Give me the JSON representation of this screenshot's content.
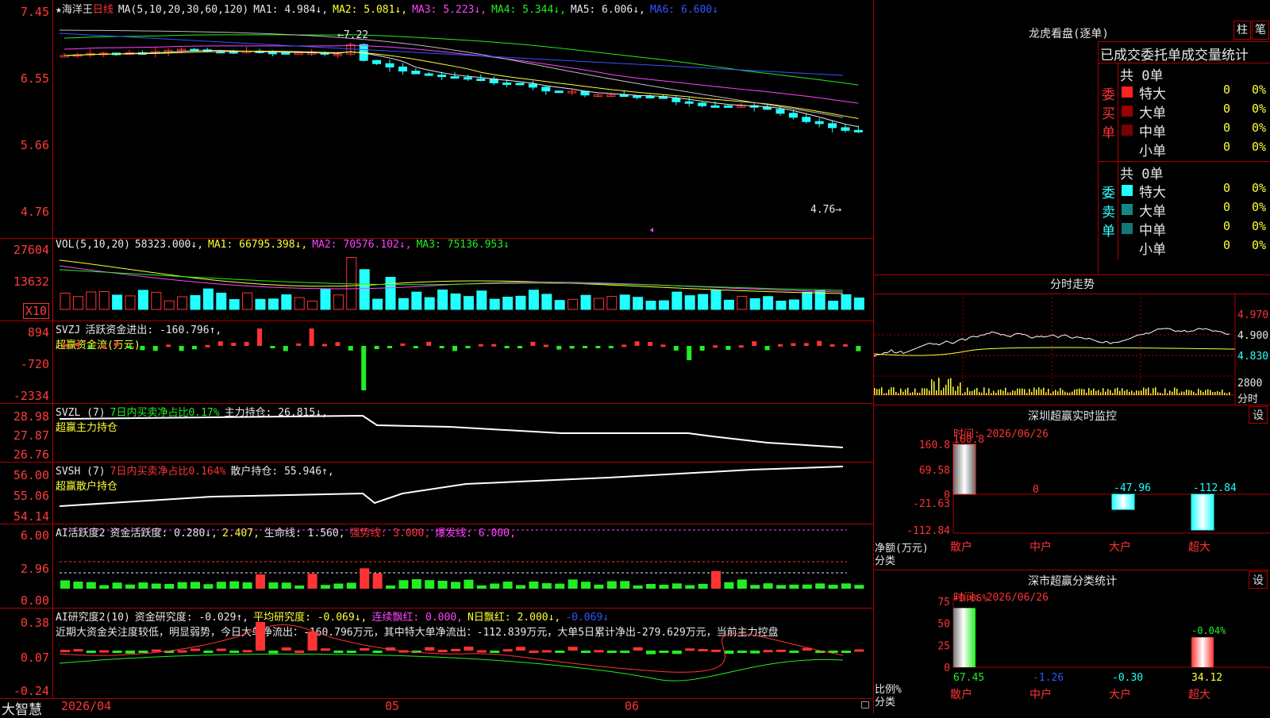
{
  "colors": {
    "up": "#ff3333",
    "down": "#22ffff",
    "bg": "#000000",
    "grid": "#aa0000"
  },
  "main": {
    "star": "★",
    "stock": "海洋王",
    "period": "日线",
    "ma_params": "MA(5,10,20,30,60,120)",
    "ma": [
      {
        "label": "MA1: 4.984↓,",
        "color": "#e8e8e8"
      },
      {
        "label": "MA2: 5.081↓,",
        "color": "#ffff33"
      },
      {
        "label": "MA3: 5.223↓,",
        "color": "#ff44ff"
      },
      {
        "label": "MA4: 5.344↓,",
        "color": "#22ee22"
      },
      {
        "label": "MA5: 6.006↓,",
        "color": "#e8e8e8"
      },
      {
        "label": "MA6: 6.600↓",
        "color": "#3355ff"
      }
    ],
    "yticks": [
      "7.45",
      "6.55",
      "5.66",
      "4.76"
    ],
    "high_label": "7.22",
    "low_label": "4.76"
  },
  "vol": {
    "title": "VOL(5,10,20)",
    "value": "58323.000↓,",
    "ma1": "MA1: 66795.398↓,",
    "ma2": "MA2: 70576.102↓,",
    "ma3": "MA3: 75136.953↓",
    "yticks": [
      "27604",
      "13632"
    ],
    "unit": "X10"
  },
  "svzj": {
    "title": "SVZJ",
    "desc": "活跃资金进出: -160.796↑,",
    "sub": "超赢资金流(万元)",
    "yticks": [
      "894",
      "-720",
      "-2334"
    ]
  },
  "svzl": {
    "title": "SVZL (7)",
    "desc": "7日内买卖净占比0.17%",
    "hold": "主力持仓: 26.815↓,",
    "sub": "超赢主力持仓",
    "yticks": [
      "28.98",
      "27.87",
      "26.76"
    ]
  },
  "svsh": {
    "title": "SVSH (7)",
    "desc": "7日内买卖净占比0.164%",
    "hold": "散户持仓: 55.946↑,",
    "sub": "超赢散户持仓",
    "yticks": [
      "56.00",
      "55.06",
      "54.14"
    ]
  },
  "ai1": {
    "title": "AI活跃度2",
    "a": "资金活跃度: 0.280↓,",
    "b": "2.407,",
    "c": "生命线: 1.560,",
    "d": "强势线: 3.000,",
    "e": "爆发线: 6.000,",
    "yticks": [
      "6.00",
      "2.96",
      "0.00"
    ]
  },
  "ai2": {
    "title": "AI研究度2(10)",
    "a": "资金研究度: -0.029↑,",
    "b": "平均研究度: -0.069↓,",
    "c": "连续飘红: 0.000,",
    "d": "N日飘红: 2.000↓,",
    "e": "-0.069↓",
    "comment": "近期大资金关注度较低，明显弱势，今日大单净流出：-160.796万元，其中特大单净流出：-112.839万元，大单5日累计净出-279.629万元，当前主力控盘",
    "yticks": [
      "0.38",
      "0.07",
      "-0.24"
    ]
  },
  "xaxis": {
    "labels": [
      "2026/04",
      "05",
      "06"
    ]
  },
  "brand": "大智慧",
  "right": {
    "lh_title": "龙虎看盘(逐单)",
    "btn_zhu": "柱",
    "btn_bi": "笔",
    "stat_title": "已成交委托单成交量统计",
    "buy": {
      "side": "委买单",
      "total": "共 0单",
      "rows": [
        {
          "name": "特大",
          "qty": "0",
          "pct": "0%",
          "color": "#ff2222"
        },
        {
          "name": "大单",
          "qty": "0",
          "pct": "0%",
          "color": "#990000"
        },
        {
          "name": "中单",
          "qty": "0",
          "pct": "0%",
          "color": "#770000"
        },
        {
          "name": "小单",
          "qty": "0",
          "pct": "0%",
          "color": "#000000"
        }
      ]
    },
    "sell": {
      "side": "委卖单",
      "total": "共 0单",
      "rows": [
        {
          "name": "特大",
          "qty": "0",
          "pct": "0%",
          "color": "#22ffff"
        },
        {
          "name": "大单",
          "qty": "0",
          "pct": "0%",
          "color": "#118888"
        },
        {
          "name": "中单",
          "qty": "0",
          "pct": "0%",
          "color": "#117777"
        },
        {
          "name": "小单",
          "qty": "0",
          "pct": "0%",
          "color": "#000000"
        }
      ]
    },
    "ts_title": "分时走势",
    "ts_yticks": [
      "4.970",
      "4.900",
      "4.830",
      "2800"
    ],
    "ts_unit": "分时",
    "mon_title": "深圳超赢实时监控",
    "mon_time": "时间: 2026/06/26",
    "mon_btn": "设",
    "mon_yticks": [
      "160.8",
      "69.58",
      "0",
      "-21.63",
      "-112.84"
    ],
    "mon_unit": "净额(万元)",
    "mon_cat": "分类",
    "cls_title": "深市超赢分类统计",
    "cls_time": "时间: 2026/06/26",
    "cls_btn": "设",
    "cls_yticks": [
      "75",
      "50",
      "25",
      "0"
    ],
    "cls_unit": "比例%",
    "cls_cat": "分类"
  },
  "chart_data": [
    {
      "type": "bar",
      "title": "深圳超赢实时监控",
      "categories": [
        "散户",
        "中户",
        "大户",
        "超大"
      ],
      "values": [
        160.8,
        0,
        -47.96,
        -112.84
      ],
      "ylabel": "净额(万元)",
      "ylim": [
        -112.84,
        160.8
      ]
    },
    {
      "type": "bar",
      "title": "深市超赢分类统计",
      "categories": [
        "散户",
        "中户",
        "大户",
        "超大"
      ],
      "values": [
        67.45,
        -1.26,
        -0.3,
        34.12
      ],
      "change": [
        "+0.06%",
        "",
        "",
        "-0.04%"
      ],
      "ylabel": "比例%",
      "ylim": [
        0,
        75
      ]
    }
  ]
}
